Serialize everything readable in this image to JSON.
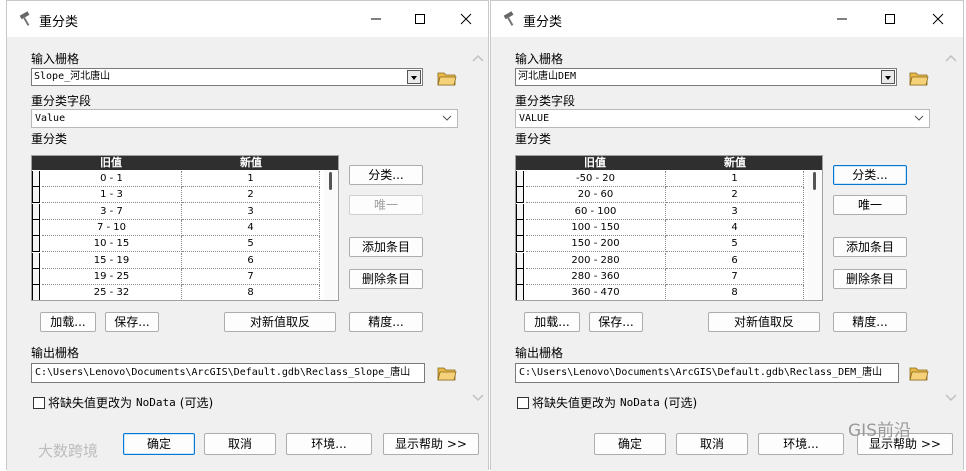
{
  "windows": [
    {
      "title": "重分类",
      "input_raster": {
        "label": "输入栅格",
        "value": "Slope_河北唐山"
      },
      "reclass_field": {
        "label": "重分类字段",
        "value": "Value"
      },
      "reclass_label": "重分类",
      "table": {
        "headers": [
          "旧值",
          "新值"
        ],
        "rows": [
          [
            "0 - 1",
            "1"
          ],
          [
            "1 - 3",
            "2"
          ],
          [
            "3 - 7",
            "3"
          ],
          [
            "7 - 10",
            "4"
          ],
          [
            "10 - 15",
            "5"
          ],
          [
            "15 - 19",
            "6"
          ],
          [
            "19 - 25",
            "7"
          ],
          [
            "25 - 32",
            "8"
          ]
        ]
      },
      "side_buttons": {
        "classify": "分类...",
        "unique": "唯一",
        "add_entry": "添加条目",
        "delete_entry": "删除条目"
      },
      "bottom_buttons": {
        "load": "加载...",
        "save": "保存...",
        "reverse": "对新值取反",
        "precision": "精度..."
      },
      "output_raster": {
        "label": "输出栅格",
        "value": "C:\\Users\\Lenovo\\Documents\\ArcGIS\\Default.gdb\\Reclass_Slope_唐山"
      },
      "nodata_checkbox": {
        "pre": "将缺失值更改为",
        "nodata": "NoData",
        "post": "(可选)"
      },
      "footer": {
        "ok": "确定",
        "cancel": "取消",
        "env": "环境...",
        "help": "显示帮助 >>"
      }
    },
    {
      "title": "重分类",
      "input_raster": {
        "label": "输入栅格",
        "value": "河北唐山DEM"
      },
      "reclass_field": {
        "label": "重分类字段",
        "value": "VALUE"
      },
      "reclass_label": "重分类",
      "table": {
        "headers": [
          "旧值",
          "新值"
        ],
        "rows": [
          [
            "-50 - 20",
            "1"
          ],
          [
            "20 - 60",
            "2"
          ],
          [
            "60 - 100",
            "3"
          ],
          [
            "100 - 150",
            "4"
          ],
          [
            "150 - 200",
            "5"
          ],
          [
            "200 - 280",
            "6"
          ],
          [
            "280 - 360",
            "7"
          ],
          [
            "360 - 470",
            "8"
          ]
        ]
      },
      "side_buttons": {
        "classify": "分类...",
        "unique": "唯一",
        "add_entry": "添加条目",
        "delete_entry": "删除条目"
      },
      "bottom_buttons": {
        "load": "加载...",
        "save": "保存...",
        "reverse": "对新值取反",
        "precision": "精度..."
      },
      "output_raster": {
        "label": "输出栅格",
        "value": "C:\\Users\\Lenovo\\Documents\\ArcGIS\\Default.gdb\\Reclass_DEM_唐山"
      },
      "nodata_checkbox": {
        "pre": "将缺失值更改为",
        "nodata": "NoData",
        "post": "(可选)"
      },
      "footer": {
        "ok": "确定",
        "cancel": "取消",
        "env": "环境...",
        "help": "显示帮助 >>"
      }
    }
  ],
  "watermarks": {
    "left": "大数跨境",
    "right": "GIS前沿"
  },
  "icons": {
    "app": "hammer-icon",
    "minimize": "minimize-icon",
    "maximize": "maximize-icon",
    "close": "close-icon",
    "folder": "folder-open-icon"
  },
  "colors": {
    "window_bg": "#f0f0f0",
    "header_bg": "#2f2f2f",
    "focus": "#0078d4",
    "folder": "#e8b84a"
  }
}
